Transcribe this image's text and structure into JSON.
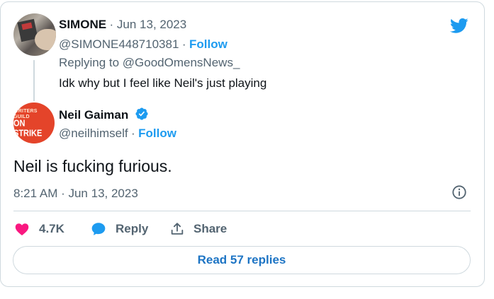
{
  "reply_tweet": {
    "name": "SIMONE",
    "date": "· Jun 13, 2023",
    "handle": "@SIMONE448710381",
    "follow_label": "Follow",
    "replying_prefix": "Replying to",
    "replying_to": "@GoodOmensNews_",
    "text": "Idk why but I feel like Neil's just playing"
  },
  "main_tweet": {
    "name": "Neil Gaiman",
    "handle": "@neilhimself",
    "follow_label": "Follow",
    "avatar_line1": "WRITERS GUILD",
    "avatar_line2": "ON STRIKE",
    "text": "Neil is fucking furious.",
    "timestamp": "8:21 AM · Jun 13, 2023"
  },
  "actions": {
    "likes": "4.7K",
    "reply_label": "Reply",
    "share_label": "Share"
  },
  "read_replies_label": "Read 57 replies",
  "colors": {
    "accent": "#1d9bf0",
    "like": "#f91880",
    "avatar_bg": "#e4442a"
  },
  "icons": [
    "twitter-bird-icon",
    "verified-badge-icon",
    "info-icon",
    "heart-icon",
    "reply-bubble-icon",
    "share-icon"
  ]
}
